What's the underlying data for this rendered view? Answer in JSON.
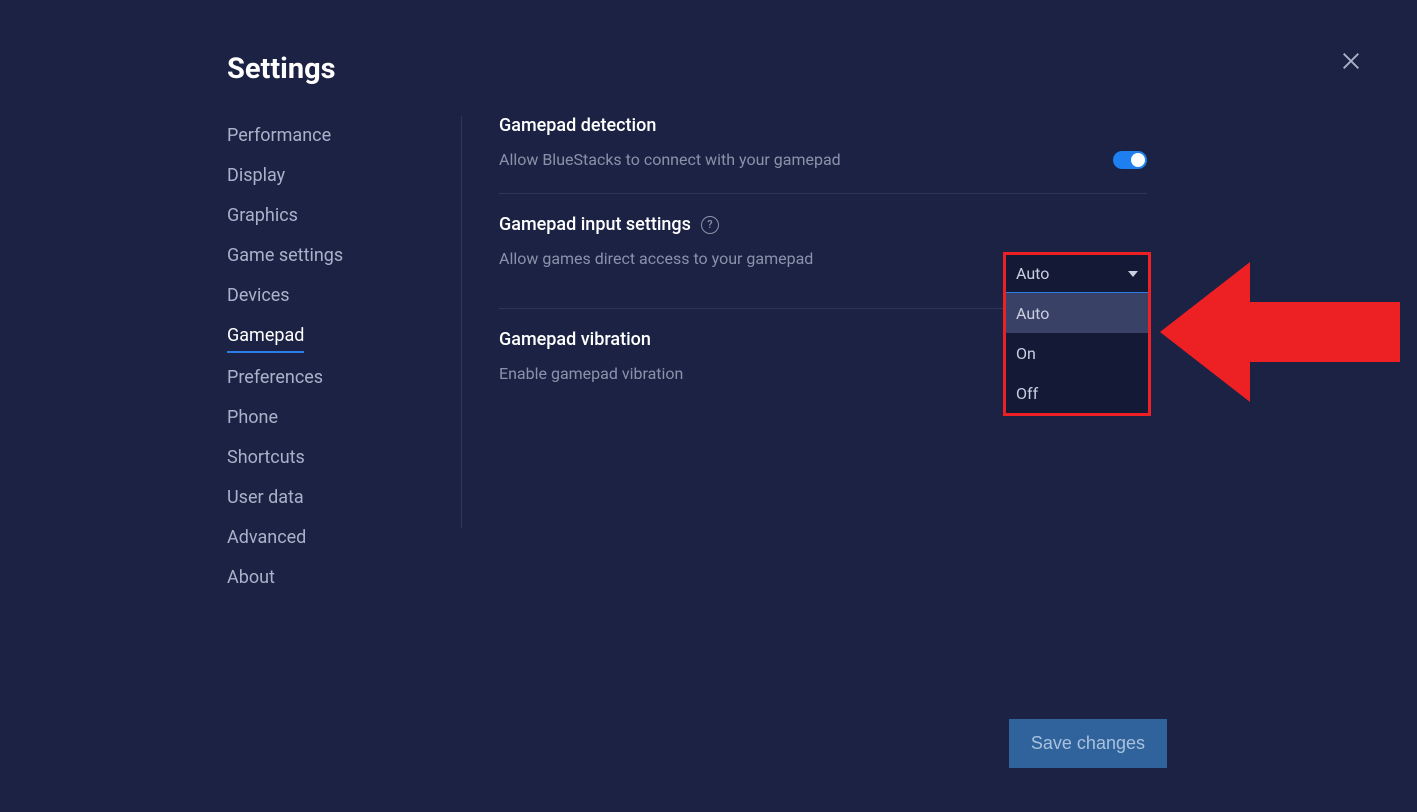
{
  "title": "Settings",
  "sidebar": {
    "items": [
      {
        "label": "Performance"
      },
      {
        "label": "Display"
      },
      {
        "label": "Graphics"
      },
      {
        "label": "Game settings"
      },
      {
        "label": "Devices"
      },
      {
        "label": "Gamepad",
        "active": true
      },
      {
        "label": "Preferences"
      },
      {
        "label": "Phone"
      },
      {
        "label": "Shortcuts"
      },
      {
        "label": "User data"
      },
      {
        "label": "Advanced"
      },
      {
        "label": "About"
      }
    ]
  },
  "sections": {
    "detection": {
      "title": "Gamepad detection",
      "desc": "Allow BlueStacks to connect with your gamepad",
      "toggle": true
    },
    "input": {
      "title": "Gamepad input settings",
      "desc": "Allow games direct access to your gamepad",
      "dropdown": {
        "selected": "Auto",
        "options": [
          "Auto",
          "On",
          "Off"
        ]
      }
    },
    "vibration": {
      "title": "Gamepad vibration",
      "desc": "Enable gamepad vibration"
    }
  },
  "footer": {
    "save_label": "Save changes"
  }
}
